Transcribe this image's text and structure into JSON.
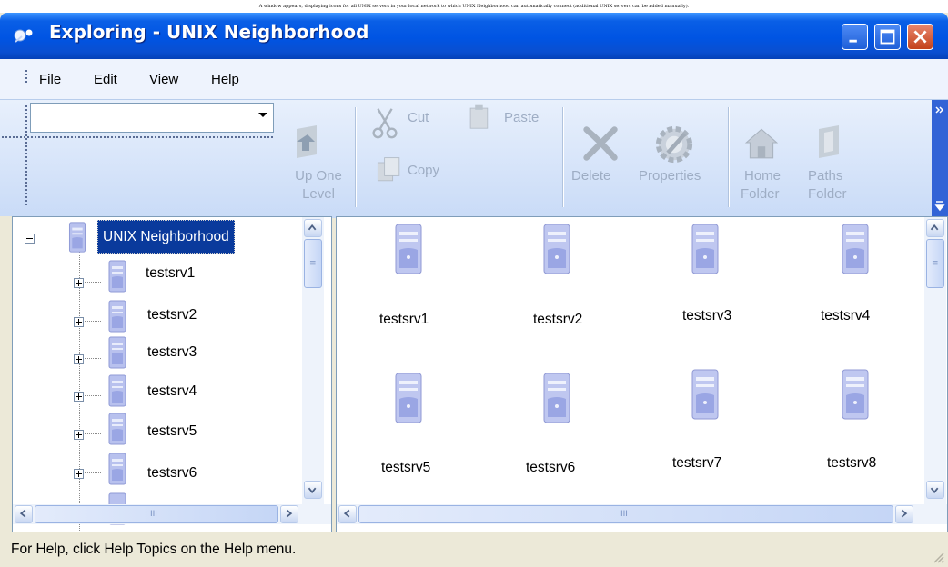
{
  "caption": "A window appears, displaying icons for all UNIX servers in your local network to which UNIX Neighborhood can automatically connect (additional UNIX servers can be added manually).",
  "window": {
    "title": "Exploring - UNIX Neighborhood"
  },
  "menu": {
    "items": [
      {
        "label": "File"
      },
      {
        "label": "Edit"
      },
      {
        "label": "View"
      },
      {
        "label": "Help"
      }
    ]
  },
  "address": {
    "value": ""
  },
  "toolbar": {
    "up_one_level_line1": "Up One",
    "up_one_level_line2": "Level",
    "cut": "Cut",
    "copy": "Copy",
    "paste": "Paste",
    "delete": "Delete",
    "properties": "Properties",
    "home_folder_line1": "Home",
    "home_folder_line2": "Folder",
    "paths_folder_line1": "Paths",
    "paths_folder_line2": "Folder"
  },
  "tree": {
    "root": "UNIX Neighborhood",
    "children": [
      "testsrv1",
      "testsrv2",
      "testsrv3",
      "testsrv4",
      "testsrv5",
      "testsrv6"
    ]
  },
  "servers": [
    "testsrv1",
    "testsrv2",
    "testsrv3",
    "testsrv4",
    "testsrv5",
    "testsrv6",
    "testsrv7",
    "testsrv8"
  ],
  "scroll_grip": "III",
  "status": {
    "text": "For Help, click Help Topics on the Help menu."
  }
}
